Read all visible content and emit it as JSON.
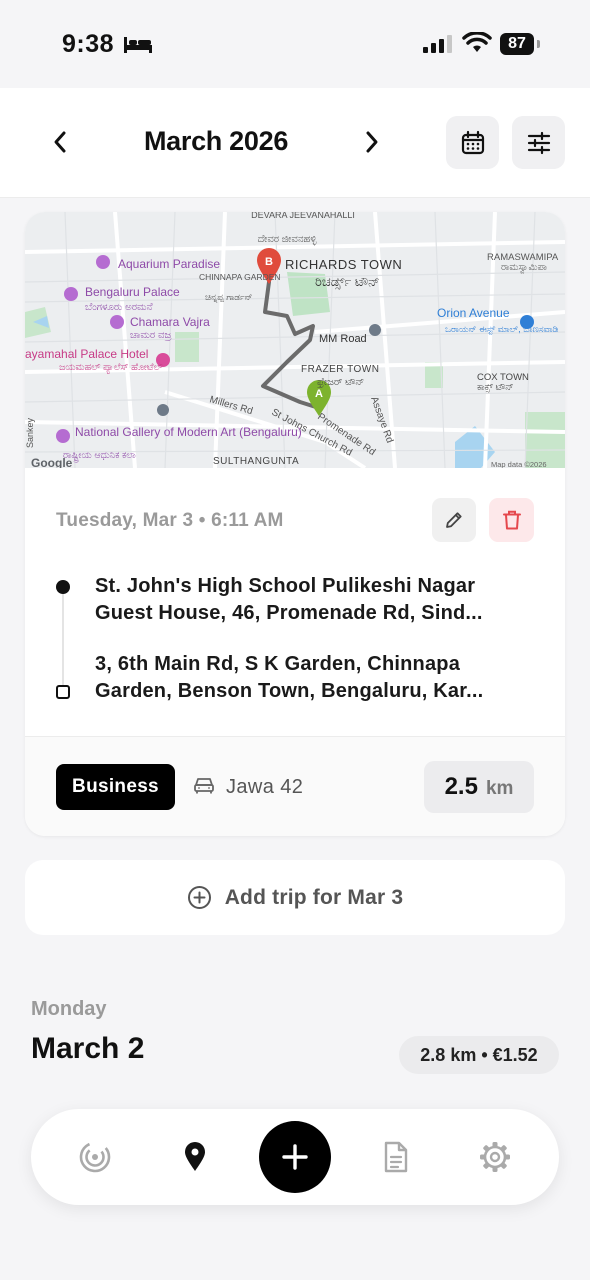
{
  "status_bar": {
    "time": "9:38",
    "battery": "87",
    "icons": [
      "bed-icon",
      "signal-icon",
      "wifi-icon",
      "battery-icon"
    ]
  },
  "header": {
    "title": "March 2026",
    "icons": [
      "chevron-left-icon",
      "chevron-right-icon",
      "calendar-icon",
      "sliders-icon"
    ]
  },
  "map": {
    "labels": {
      "devara_jeevanahalli": "DEVARA JEEVANAHALLI",
      "devara_jeevanahalli_kn": "ದೇವರ ಜೀವನಹಳ್ಳಿ",
      "aquarium": "Aquarium Paradise",
      "chinnapa_garden": "CHINNAPA GARDEN",
      "chinnapa_garden_kn": "ಚಿನ್ನಪ್ಪ ಗಾರ್ಡನ್",
      "richards_town": "RICHARDS TOWN",
      "richards_town_kn": "ರಿಚರ್ಡ್ಸ್ ಟೌನ್",
      "ramaswamipalya": "RAMASWAMIPA",
      "ramaswamipalya_kn": "ರಾಮಸ್ವಾಮಿಪಾ",
      "bangalore_palace": "Bengaluru Palace",
      "bangalore_palace_kn": "ಬೆಂಗಳೂರು ಅರಮನೆ",
      "orion_avenue": "Orion Avenue",
      "orion_avenue_kn": "ಒರಾಯನ್ ಈಸ್ಟ್ ಮಾಲ್, ಬಾಣಸವಾಡಿ",
      "chamara_vajra": "Chamara Vajra",
      "chamara_vajra_kn": "ಚಾಮರ ವಜ್ರ",
      "mm_road": "MM Road",
      "jayamahal": "ayamahal Palace Hotel",
      "jayamahal_kn": "ಜಯಮಹಲ್ ಪ್ಯಾಲೆಸ್ ಹೋಟೆಲ್",
      "frazer_town": "FRAZER TOWN",
      "frazer_town_kn": "ಫ್ರೇಜರ್ ಟೌನ್",
      "cox_town": "COX TOWN",
      "cox_town_kn": "ಕಾಕ್ಸ್ ಟೌನ್",
      "millers_rd": "Millers Rd",
      "st_johns_church_rd": "St Johns Church Rd",
      "promenade_rd": "Promenade Rd",
      "assaye_rd": "Assaye Rd",
      "national_gallery": "National Gallery of Modern Art (Bengaluru)",
      "national_gallery_kn": "ರಾಷ್ಟ್ರೀಯ ಆಧುನಿಕ ಕಲಾ",
      "sankey": "Sankey",
      "sulthanagunta": "SULTHANGUNTA",
      "google": "Google",
      "map_data": "Map data ©2026",
      "marker_a": "A",
      "marker_b": "B"
    }
  },
  "trip": {
    "datetime": "Tuesday, Mar 3 • 6:11 AM",
    "start_line1": "St. John's High School Pulikeshi Nagar",
    "start_line2": "Guest House, 46, Promenade Rd, Sind...",
    "end_line1": "3, 6th Main Rd, S K Garden, Chinnapa",
    "end_line2": "Garden, Benson Town, Bengaluru, Kar...",
    "category": "Business",
    "vehicle": "Jawa 42",
    "distance_value": "2.5",
    "distance_unit": "km",
    "icons": [
      "pencil-icon",
      "trash-icon",
      "car-icon"
    ],
    "colors": {
      "delete": "#e5484d",
      "delete_bg": "#fde8ea"
    }
  },
  "add_trip": {
    "label": "Add trip for Mar 3",
    "icon": "plus-circle-icon"
  },
  "day_section": {
    "weekday": "Monday",
    "date": "March 2",
    "summary": "2.8 km • €1.52"
  },
  "tabbar": {
    "icons": [
      "radar-icon",
      "map-pin-icon",
      "plus-icon",
      "document-icon",
      "gear-icon"
    ]
  }
}
